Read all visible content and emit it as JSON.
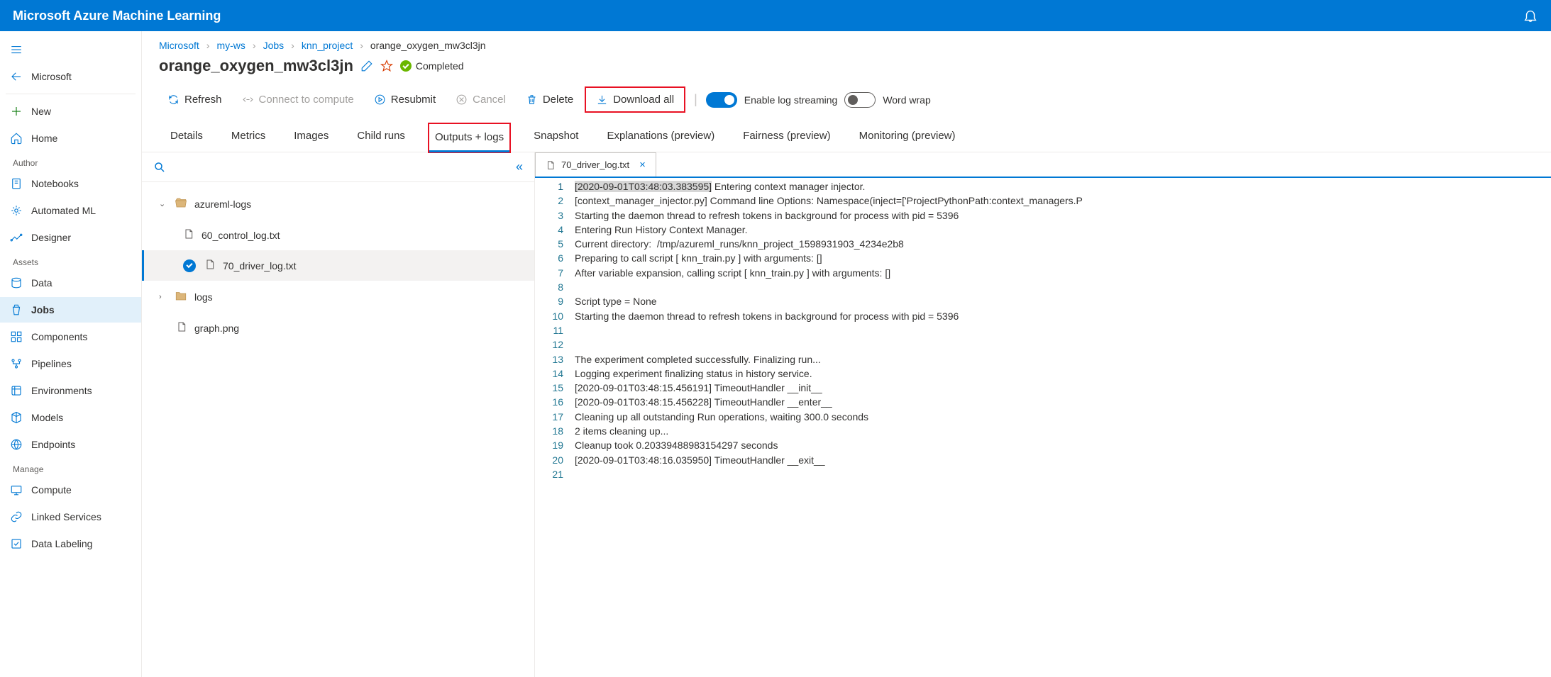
{
  "topbar": {
    "title": "Microsoft Azure Machine Learning"
  },
  "sidebar": {
    "back": "Microsoft",
    "new": "New",
    "home": "Home",
    "sections": {
      "author": "Author",
      "assets": "Assets",
      "manage": "Manage"
    },
    "items": {
      "notebooks": "Notebooks",
      "automl": "Automated ML",
      "designer": "Designer",
      "data": "Data",
      "jobs": "Jobs",
      "components": "Components",
      "pipelines": "Pipelines",
      "environments": "Environments",
      "models": "Models",
      "endpoints": "Endpoints",
      "compute": "Compute",
      "linked": "Linked Services",
      "labeling": "Data Labeling"
    }
  },
  "breadcrumb": [
    "Microsoft",
    "my-ws",
    "Jobs",
    "knn_project",
    "orange_oxygen_mw3cl3jn"
  ],
  "page_title": "orange_oxygen_mw3cl3jn",
  "status": "Completed",
  "actions": {
    "refresh": "Refresh",
    "connect": "Connect to compute",
    "resubmit": "Resubmit",
    "cancel": "Cancel",
    "delete": "Delete",
    "download": "Download all",
    "log_stream": "Enable log streaming",
    "word_wrap": "Word wrap"
  },
  "tabs": [
    "Details",
    "Metrics",
    "Images",
    "Child runs",
    "Outputs + logs",
    "Snapshot",
    "Explanations (preview)",
    "Fairness (preview)",
    "Monitoring (preview)"
  ],
  "active_tab": 4,
  "file_tree": {
    "folder1": "azureml-logs",
    "file1": "60_control_log.txt",
    "file2": "70_driver_log.txt",
    "folder2": "logs",
    "file3": "graph.png"
  },
  "editor": {
    "open_tab": "70_driver_log.txt",
    "lines": [
      "[2020-09-01T03:48:03.383595] Entering context manager injector.",
      "[context_manager_injector.py] Command line Options: Namespace(inject=['ProjectPythonPath:context_managers.P",
      "Starting the daemon thread to refresh tokens in background for process with pid = 5396",
      "Entering Run History Context Manager.",
      "Current directory:  /tmp/azureml_runs/knn_project_1598931903_4234e2b8",
      "Preparing to call script [ knn_train.py ] with arguments: []",
      "After variable expansion, calling script [ knn_train.py ] with arguments: []",
      "",
      "Script type = None",
      "Starting the daemon thread to refresh tokens in background for process with pid = 5396",
      "",
      "",
      "The experiment completed successfully. Finalizing run...",
      "Logging experiment finalizing status in history service.",
      "[2020-09-01T03:48:15.456191] TimeoutHandler __init__",
      "[2020-09-01T03:48:15.456228] TimeoutHandler __enter__",
      "Cleaning up all outstanding Run operations, waiting 300.0 seconds",
      "2 items cleaning up...",
      "Cleanup took 0.20339488983154297 seconds",
      "[2020-09-01T03:48:16.035950] TimeoutHandler __exit__",
      ""
    ]
  }
}
